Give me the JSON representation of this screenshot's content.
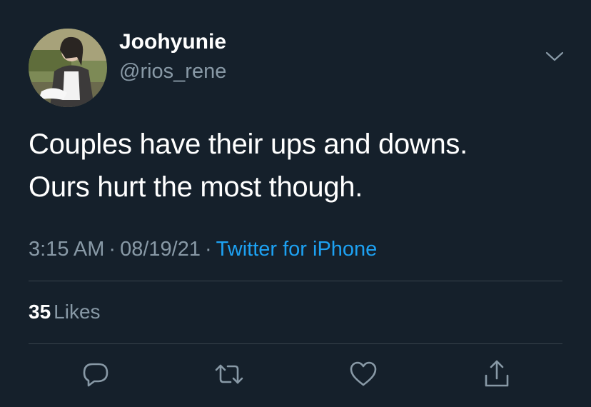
{
  "author": {
    "display_name": "Joohyunie",
    "handle": "@rios_rene",
    "avatar_icon": "profile-photo"
  },
  "tweet": {
    "text_lines": [
      "Couples have their ups and downs.",
      "Ours hurt the most though."
    ],
    "time": "3:15 AM",
    "date": "08/19/21",
    "separator": "·",
    "source": "Twitter for iPhone"
  },
  "stats": {
    "likes_count": "35",
    "likes_label": "Likes"
  },
  "actions": [
    {
      "name": "reply",
      "icon": "speech-bubble-icon"
    },
    {
      "name": "retweet",
      "icon": "retweet-arrows-icon"
    },
    {
      "name": "like",
      "icon": "heart-icon"
    },
    {
      "name": "share",
      "icon": "share-upload-icon"
    }
  ],
  "colors": {
    "background": "#15202b",
    "primary_text": "#ffffff",
    "secondary_text": "#8899a6",
    "link": "#1da1f2",
    "divider": "#38444d"
  }
}
